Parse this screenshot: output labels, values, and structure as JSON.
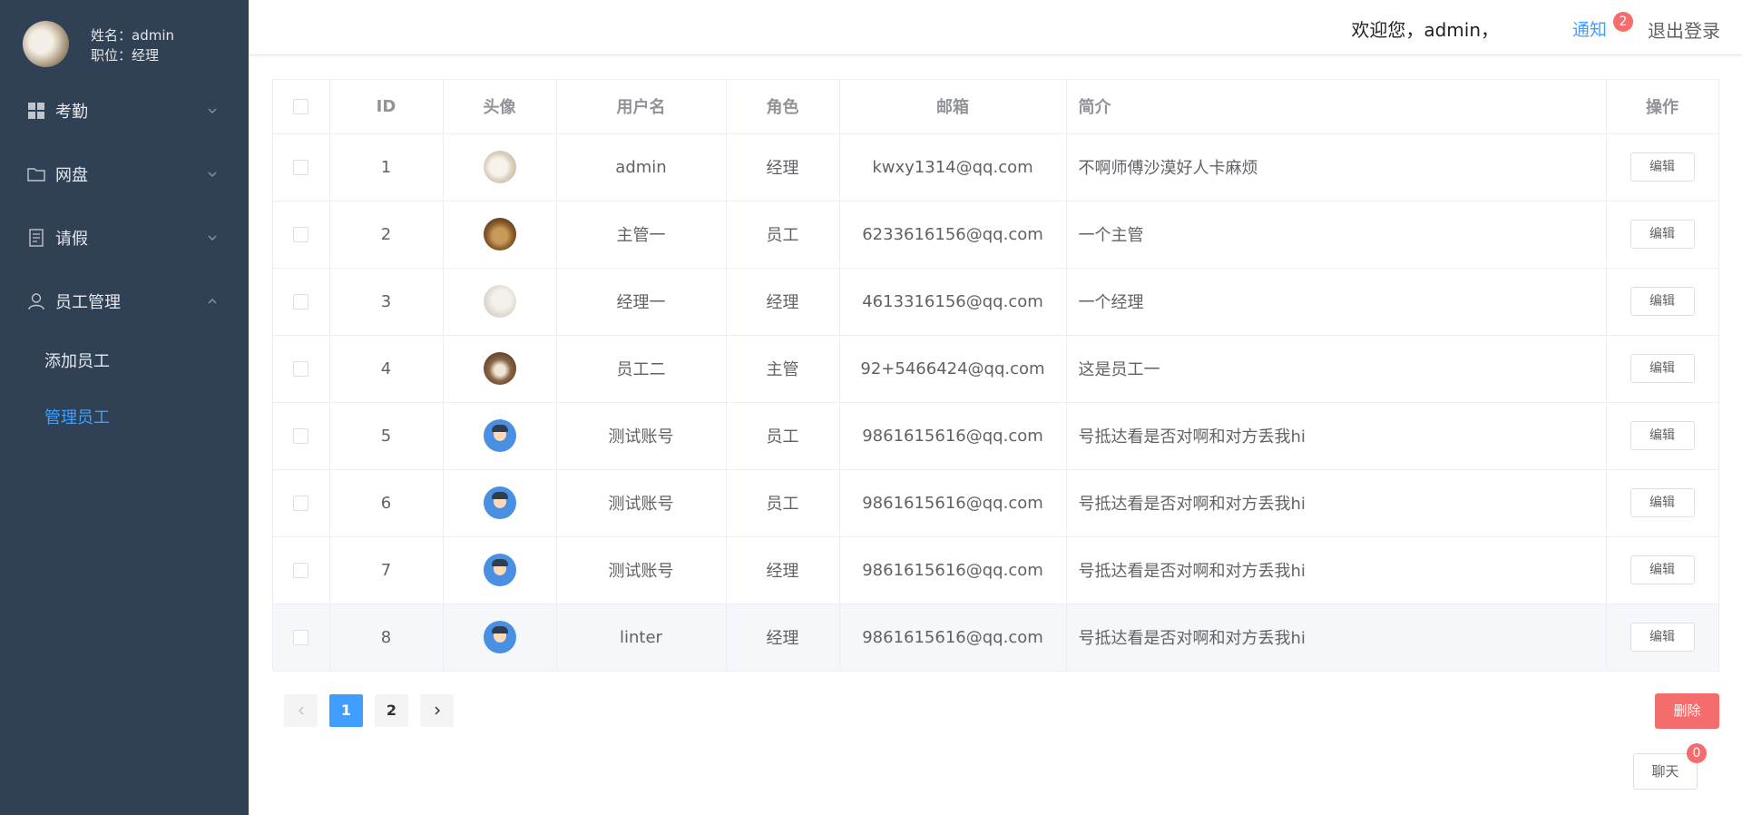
{
  "profile": {
    "name": "姓名：admin",
    "role": "职位：经理"
  },
  "sidebar": {
    "items": [
      {
        "label": "考勤",
        "icon": "grid-icon"
      },
      {
        "label": "网盘",
        "icon": "folder-icon"
      },
      {
        "label": "请假",
        "icon": "document-icon"
      },
      {
        "label": "员工管理",
        "icon": "user-icon"
      }
    ],
    "subitems": [
      {
        "label": "添加员工"
      },
      {
        "label": "管理员工"
      }
    ]
  },
  "header": {
    "welcome": "欢迎您，admin，",
    "notice": "通知",
    "notice_count": "2",
    "logout": "退出登录"
  },
  "table": {
    "columns": [
      "ID",
      "头像",
      "用户名",
      "角色",
      "邮箱",
      "简介",
      "操作"
    ],
    "edit_label": "编辑",
    "rows": [
      {
        "id": "1",
        "avatar": "cat",
        "username": "admin",
        "role": "经理",
        "email": "kwxy1314@qq.com",
        "intro": "不啊师傅沙漠好人卡麻烦"
      },
      {
        "id": "2",
        "avatar": "dog",
        "username": "主管一",
        "role": "员工",
        "email": "6233616156@qq.com",
        "intro": "一个主管"
      },
      {
        "id": "3",
        "avatar": "cat",
        "username": "经理一",
        "role": "经理",
        "email": "4613316156@qq.com",
        "intro": "一个经理"
      },
      {
        "id": "4",
        "avatar": "dog",
        "username": "员工二",
        "role": "主管",
        "email": "92+5466424@qq.com",
        "intro": "这是员工一"
      },
      {
        "id": "5",
        "avatar": "boy",
        "username": "测试账号",
        "role": "员工",
        "email": "9861615616@qq.com",
        "intro": "号抵达看是否对啊和对方丢我hi"
      },
      {
        "id": "6",
        "avatar": "boy",
        "username": "测试账号",
        "role": "员工",
        "email": "9861615616@qq.com",
        "intro": "号抵达看是否对啊和对方丢我hi"
      },
      {
        "id": "7",
        "avatar": "boy",
        "username": "测试账号",
        "role": "经理",
        "email": "9861615616@qq.com",
        "intro": "号抵达看是否对啊和对方丢我hi"
      },
      {
        "id": "8",
        "avatar": "boy",
        "username": "linter",
        "role": "经理",
        "email": "9861615616@qq.com",
        "intro": "号抵达看是否对啊和对方丢我hi"
      }
    ]
  },
  "pagination": {
    "pages": [
      "1",
      "2"
    ],
    "current": "1"
  },
  "actions": {
    "delete": "删除",
    "chat": "聊天",
    "chat_count": "0"
  },
  "colors": {
    "sidebar_bg": "#304156",
    "accent": "#409eff",
    "danger": "#f56c6c"
  }
}
